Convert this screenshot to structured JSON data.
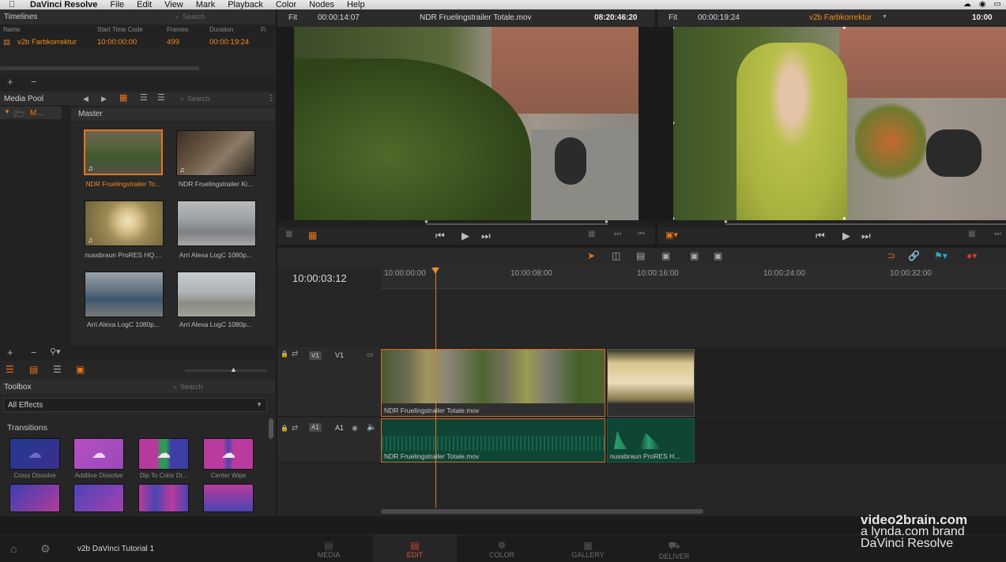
{
  "menubar": {
    "app_name": "DaVinci Resolve",
    "items": [
      "File",
      "Edit",
      "View",
      "Mark",
      "Playback",
      "Color",
      "Nodes",
      "Help"
    ]
  },
  "timelines": {
    "title": "Timelines",
    "search_placeholder": "Search",
    "columns": [
      "Name",
      "Start Time Code",
      "Frames",
      "Duration",
      "Fi"
    ],
    "rows": [
      {
        "name": "v2b Farbkorrektur",
        "start": "10:00:00:00",
        "frames": "499",
        "duration": "00:00:19:24"
      }
    ]
  },
  "media_pool": {
    "title": "Media Pool",
    "tree_item": "M...",
    "search_placeholder": "Search",
    "folder": "Master",
    "clips": [
      {
        "label": "NDR Fruelingstrailer To...",
        "selected": true,
        "audio": true
      },
      {
        "label": "NDR Fruelingstrailer Ki...",
        "selected": false,
        "audio": true
      },
      {
        "label": "nussbraun ProRES HQ....",
        "selected": false,
        "audio": true
      },
      {
        "label": "Arri Alexa LogC 1080p...",
        "selected": false,
        "audio": false
      },
      {
        "label": "Arri Alexa LogC 1080p...",
        "selected": false,
        "audio": false
      },
      {
        "label": "Arri Alexa LogC 1080p...",
        "selected": false,
        "audio": false
      }
    ]
  },
  "toolbox": {
    "title": "Toolbox",
    "search_placeholder": "Search",
    "filter": "All Effects",
    "section": "Transitions",
    "effects": [
      {
        "label": "Cross Dissolve"
      },
      {
        "label": "Additive Dissolve"
      },
      {
        "label": "Dip To Color Di..."
      },
      {
        "label": "Center Wipe"
      }
    ]
  },
  "source_viewer": {
    "zoom": "Fit",
    "timecode": "00:00:14:07",
    "clip_name": "NDR Fruelingstrailer Totale.mov",
    "source_tc": "08:20:46:20"
  },
  "record_viewer": {
    "zoom": "Fit",
    "timecode": "00:00:19:24",
    "timeline_name": "v2b Farbkorrektur",
    "tc": "10:00"
  },
  "timeline": {
    "current_tc": "10:00:03:12",
    "ruler_labels": [
      "10:00:00:00",
      "10:00:08:00",
      "10:00:16:00",
      "10:00:24:00",
      "10:00:32:00"
    ],
    "video_track": {
      "badge": "V1",
      "label": "V1"
    },
    "audio_track": {
      "badge": "A1",
      "label": "A1"
    },
    "video_clips": [
      {
        "label": "NDR Fruelingstrailer Totale.mov"
      },
      {
        "label": ""
      }
    ],
    "audio_clips": [
      {
        "label": "NDR Fruelingstrailer Totale.mov"
      },
      {
        "label": "nussbraun ProRES H..."
      }
    ]
  },
  "project": {
    "name": "v2b DaVinci Tutorial 1"
  },
  "pages": [
    {
      "label": "MEDIA",
      "active": false
    },
    {
      "label": "EDIT",
      "active": true
    },
    {
      "label": "COLOR",
      "active": false
    },
    {
      "label": "GALLERY",
      "active": false
    },
    {
      "label": "DELIVER",
      "active": false
    }
  ],
  "watermark": {
    "line1": "video2brain.com",
    "line2": "a lynda.com brand",
    "line3": "DaVinci Resolve"
  },
  "colors": {
    "accent": "#e8731b",
    "active_page": "#e0543a",
    "audio_clip": "#0f4535"
  }
}
